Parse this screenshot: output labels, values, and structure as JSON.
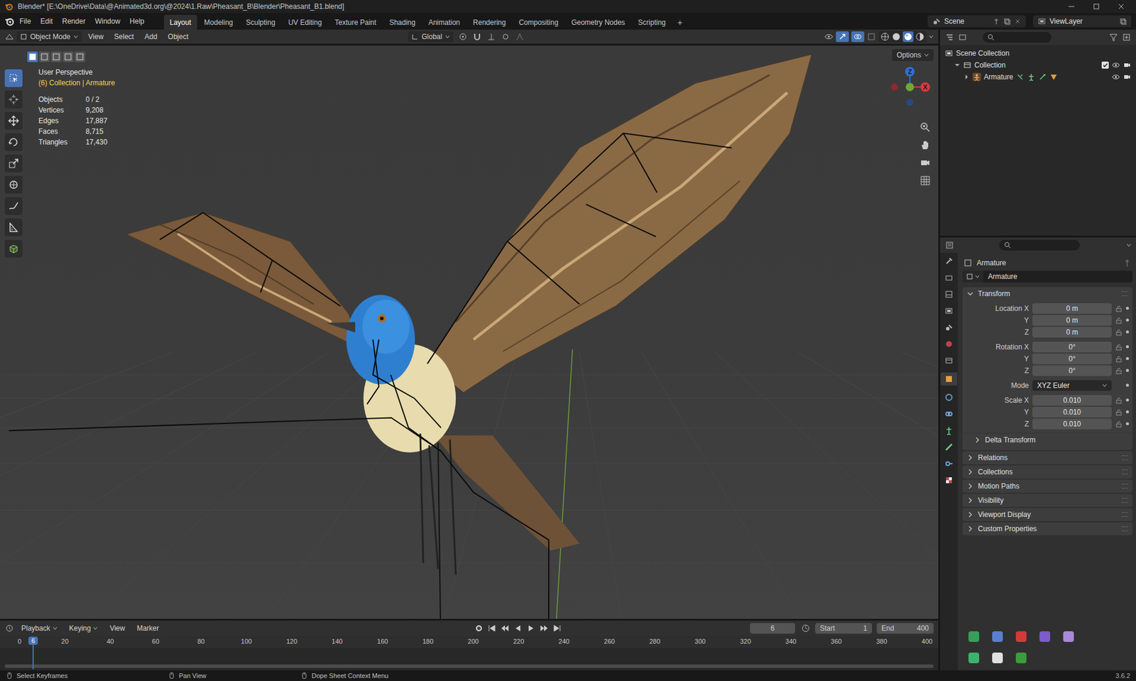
{
  "window": {
    "title": "Blender* [E:\\OneDrive\\Data\\@Animated3d.org\\@2024\\1.Raw\\Pheasant_B\\Blender\\Pheasant_B1.blend]"
  },
  "menus": [
    "File",
    "Edit",
    "Render",
    "Window",
    "Help"
  ],
  "workspaces": [
    {
      "label": "Layout",
      "selected": true
    },
    {
      "label": "Modeling",
      "selected": false
    },
    {
      "label": "Sculpting",
      "selected": false
    },
    {
      "label": "UV Editing",
      "selected": false
    },
    {
      "label": "Texture Paint",
      "selected": false
    },
    {
      "label": "Shading",
      "selected": false
    },
    {
      "label": "Animation",
      "selected": false
    },
    {
      "label": "Rendering",
      "selected": false
    },
    {
      "label": "Compositing",
      "selected": false
    },
    {
      "label": "Geometry Nodes",
      "selected": false
    },
    {
      "label": "Scripting",
      "selected": false
    }
  ],
  "add_workspace": "+",
  "scene": "Scene",
  "view_layer": "ViewLayer",
  "viewport_header": {
    "mode": "Object Mode",
    "menus": [
      "View",
      "Select",
      "Add",
      "Object"
    ],
    "orientation": "Global",
    "options": "Options"
  },
  "viewport": {
    "view_name": "User Perspective",
    "context": "(6) Collection | Armature",
    "stats": [
      {
        "label": "Objects",
        "value": "0 / 2"
      },
      {
        "label": "Vertices",
        "value": "9,208"
      },
      {
        "label": "Edges",
        "value": "17,887"
      },
      {
        "label": "Faces",
        "value": "8,715"
      },
      {
        "label": "Triangles",
        "value": "17,430"
      }
    ],
    "gizmo": [
      {
        "label": "Z",
        "color": "#2f6fd4"
      },
      {
        "label": "X",
        "color": "#d9383f"
      }
    ]
  },
  "tools": [
    {
      "kind": "select",
      "selected": true
    },
    {
      "kind": "cursor",
      "selected": false
    },
    {
      "kind": "move",
      "selected": false
    },
    {
      "kind": "rotate",
      "selected": false
    },
    {
      "kind": "scale",
      "selected": false
    },
    {
      "kind": "transform",
      "selected": false
    },
    {
      "kind": "annotate",
      "selected": false
    },
    {
      "kind": "measure",
      "selected": false
    },
    {
      "kind": "add",
      "selected": false
    }
  ],
  "outliner": {
    "items": [
      {
        "label": "Scene Collection",
        "kind": "scene",
        "depth": 0,
        "expanded": true
      },
      {
        "label": "Collection",
        "kind": "collection",
        "depth": 1,
        "expanded": true,
        "checked": true,
        "visible": true
      },
      {
        "label": "Armature",
        "kind": "object",
        "depth": 2,
        "expanded": false,
        "visible": true
      }
    ]
  },
  "properties": {
    "object_name": "Armature",
    "datablock": "Armature",
    "transform": {
      "label": "Transform",
      "expanded": true,
      "groups": [
        {
          "rows": [
            {
              "label": "Location X",
              "value": "0 m",
              "kind": "field"
            },
            {
              "label": "Y",
              "value": "0 m",
              "kind": "field"
            },
            {
              "label": "Z",
              "value": "0 m",
              "kind": "field"
            }
          ]
        },
        {
          "rows": [
            {
              "label": "Rotation X",
              "value": "0°",
              "kind": "field"
            },
            {
              "label": "Y",
              "value": "0°",
              "kind": "field"
            },
            {
              "label": "Z",
              "value": "0°",
              "kind": "field"
            }
          ]
        },
        {
          "rows": [
            {
              "label": "Mode",
              "value": "XYZ Euler",
              "kind": "dropdown"
            }
          ]
        },
        {
          "rows": [
            {
              "label": "Scale X",
              "value": "0.010",
              "kind": "field"
            },
            {
              "label": "Y",
              "value": "0.010",
              "kind": "field"
            },
            {
              "label": "Z",
              "value": "0.010",
              "kind": "field"
            }
          ]
        }
      ],
      "subpanels": [
        {
          "label": "Delta Transform",
          "expanded": false
        }
      ]
    },
    "panels": [
      {
        "label": "Relations",
        "expanded": false
      },
      {
        "label": "Collections",
        "expanded": false
      },
      {
        "label": "Motion Paths",
        "expanded": false
      },
      {
        "label": "Visibility",
        "expanded": false
      },
      {
        "label": "Viewport Display",
        "expanded": false
      },
      {
        "label": "Custom Properties",
        "expanded": false
      }
    ]
  },
  "timeline": {
    "menus": [
      {
        "label": "Playback",
        "dropdown": true
      },
      {
        "label": "Keying",
        "dropdown": true
      },
      {
        "label": "View",
        "dropdown": false
      },
      {
        "label": "Marker",
        "dropdown": false
      }
    ],
    "current_frame": "6",
    "start": {
      "label": "Start",
      "value": "1"
    },
    "end": {
      "label": "End",
      "value": "400"
    },
    "ticks": [
      "0",
      "20",
      "40",
      "60",
      "80",
      "100",
      "120",
      "140",
      "160",
      "180",
      "200",
      "220",
      "240",
      "260",
      "280",
      "300",
      "320",
      "340",
      "360",
      "380",
      "400"
    ],
    "playhead": {
      "label": "6",
      "level": 0.015
    }
  },
  "status_bar": {
    "items": [
      "Select Keyframes",
      "Pan View",
      "Dope Sheet Context Menu"
    ],
    "version": "3.6.2"
  }
}
